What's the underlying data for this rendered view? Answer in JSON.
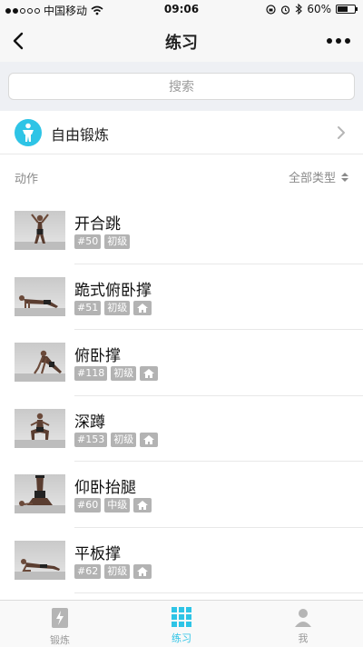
{
  "status_bar": {
    "carrier": "中国移动",
    "time": "09:06",
    "battery": "60%",
    "battery_level": 0.6
  },
  "nav": {
    "title": "练习"
  },
  "search": {
    "placeholder": "搜索"
  },
  "free_exercise": {
    "label": "自由锻炼"
  },
  "section": {
    "title": "动作",
    "filter_label": "全部类型"
  },
  "exercises": [
    {
      "name": "开合跳",
      "number": "#50",
      "level": "初级",
      "home": false
    },
    {
      "name": "跪式俯卧撑",
      "number": "#51",
      "level": "初级",
      "home": true
    },
    {
      "name": "俯卧撑",
      "number": "#118",
      "level": "初级",
      "home": true
    },
    {
      "name": "深蹲",
      "number": "#153",
      "level": "初级",
      "home": true
    },
    {
      "name": "仰卧抬腿",
      "number": "#60",
      "level": "中级",
      "home": true
    },
    {
      "name": "平板撑",
      "number": "#62",
      "level": "初级",
      "home": true
    }
  ],
  "tab_bar": {
    "tabs": [
      {
        "label": "锻炼",
        "icon": "dumbbell-icon",
        "active": false
      },
      {
        "label": "练习",
        "icon": "grid-icon",
        "active": true
      },
      {
        "label": "我",
        "icon": "profile-icon",
        "active": false
      }
    ]
  },
  "colors": {
    "accent": "#2ec4e6",
    "tag_bg": "#b3b3b3"
  }
}
